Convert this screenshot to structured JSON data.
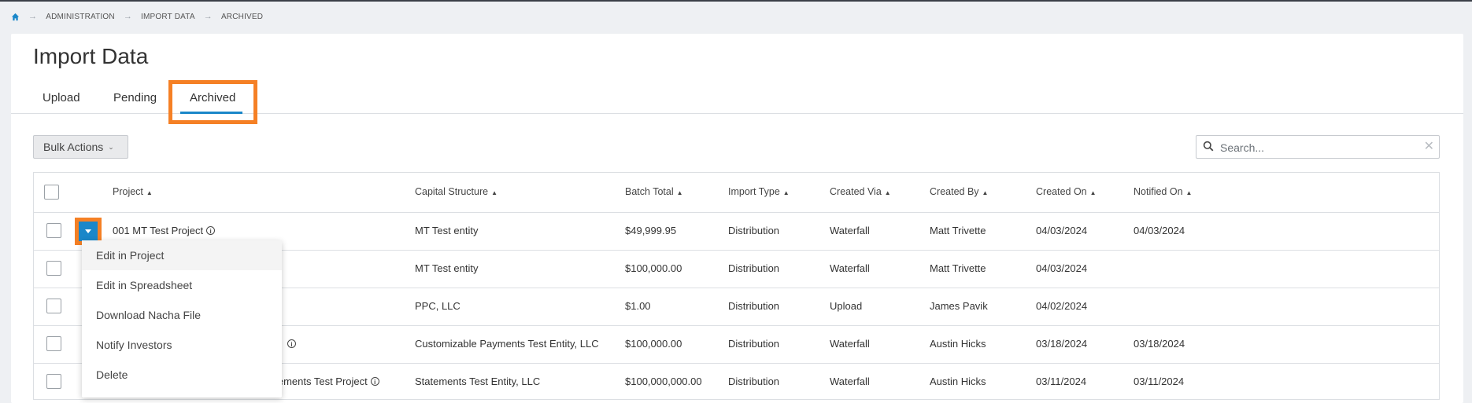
{
  "breadcrumb": {
    "items": [
      "ADMINISTRATION",
      "IMPORT DATA",
      "ARCHIVED"
    ]
  },
  "page": {
    "title": "Import Data"
  },
  "tabs": [
    {
      "label": "Upload"
    },
    {
      "label": "Pending"
    },
    {
      "label": "Archived",
      "active": true
    }
  ],
  "toolbar": {
    "bulk_actions_label": "Bulk Actions",
    "search_placeholder": "Search..."
  },
  "table": {
    "columns": [
      "Project",
      "Capital Structure",
      "Batch Total",
      "Import Type",
      "Created Via",
      "Created By",
      "Created On",
      "Notified On"
    ],
    "rows": [
      {
        "project": "001 MT Test Project",
        "capital_structure": "MT Test entity",
        "batch_total": "$49,999.95",
        "import_type": "Distribution",
        "created_via": "Waterfall",
        "created_by": "Matt Trivette",
        "created_on": "04/03/2024",
        "notified_on": "04/03/2024"
      },
      {
        "project": "",
        "capital_structure": "MT Test entity",
        "batch_total": "$100,000.00",
        "import_type": "Distribution",
        "created_via": "Waterfall",
        "created_by": "Matt Trivette",
        "created_on": "04/03/2024",
        "notified_on": ""
      },
      {
        "project": "",
        "capital_structure": "PPC, LLC",
        "batch_total": "$1.00",
        "import_type": "Distribution",
        "created_via": "Upload",
        "created_by": "James Pavik",
        "created_on": "04/02/2024",
        "notified_on": ""
      },
      {
        "project": "",
        "capital_structure": "Customizable Payments Test Entity, LLC",
        "batch_total": "$100,000.00",
        "import_type": "Distribution",
        "created_via": "Waterfall",
        "created_by": "Austin Hicks",
        "created_on": "03/18/2024",
        "notified_on": "03/18/2024"
      },
      {
        "project": "atements Test Project",
        "capital_structure": "Statements Test Entity, LLC",
        "batch_total": "$100,000,000.00",
        "import_type": "Distribution",
        "created_via": "Waterfall",
        "created_by": "Austin Hicks",
        "created_on": "03/11/2024",
        "notified_on": "03/11/2024"
      }
    ]
  },
  "row_menu": {
    "items": [
      "Edit in Project",
      "Edit in Spreadsheet",
      "Download Nacha File",
      "Notify Investors",
      "Delete"
    ]
  },
  "colors": {
    "accent": "#1a87c9",
    "highlight": "#f58025"
  }
}
